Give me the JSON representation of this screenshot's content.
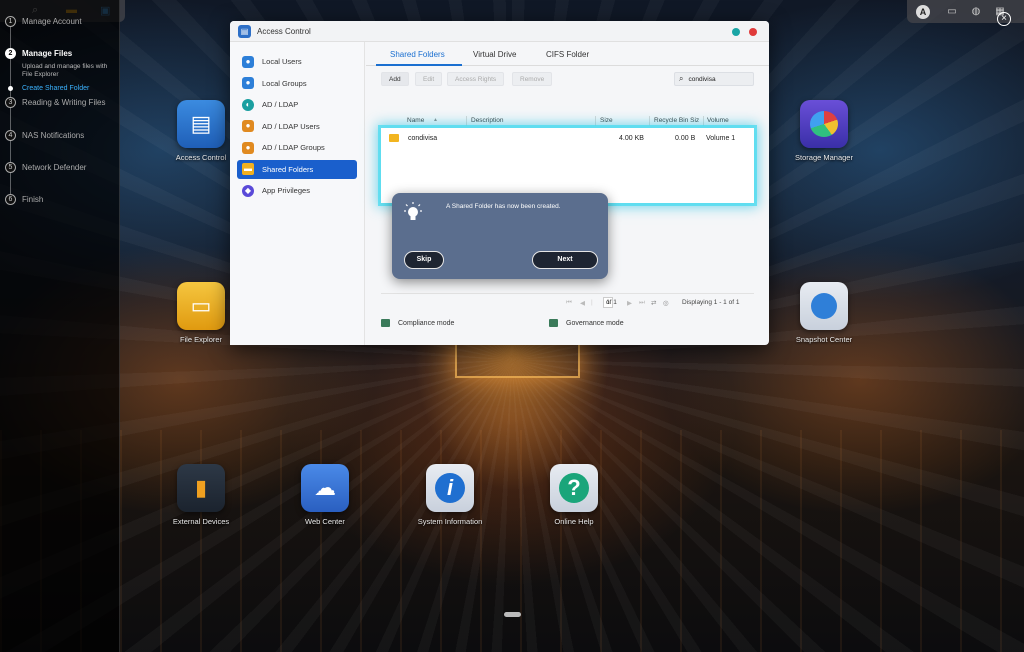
{
  "wizard": {
    "steps": [
      {
        "num": "1",
        "label": "Manage Account"
      },
      {
        "num": "2",
        "label": "Manage Files"
      },
      {
        "num": "3",
        "label": "Reading & Writing Files"
      },
      {
        "num": "4",
        "label": "NAS Notifications"
      },
      {
        "num": "5",
        "label": "Network Defender"
      },
      {
        "num": "6",
        "label": "Finish"
      }
    ],
    "sub_description": "Upload and manage files with File Explorer",
    "sub_current": "Create Shared Folder"
  },
  "desktop": {
    "icons": [
      {
        "label": "Access Control",
        "icon": "access-control-icon"
      },
      {
        "label": "File Explorer",
        "icon": "file-explorer-icon"
      },
      {
        "label": "External Devices",
        "icon": "usb-icon"
      },
      {
        "label": "Web Center",
        "icon": "web-center-icon"
      },
      {
        "label": "System Information",
        "icon": "info-icon"
      },
      {
        "label": "Online Help",
        "icon": "help-icon"
      },
      {
        "label": "Storage Manager",
        "icon": "storage-manager-icon"
      },
      {
        "label": "Snapshot Center",
        "icon": "snapshot-center-icon"
      }
    ]
  },
  "window": {
    "title": "Access Control",
    "sidebar": [
      {
        "label": "Local Users",
        "icon": "user-icon"
      },
      {
        "label": "Local Groups",
        "icon": "group-icon"
      },
      {
        "label": "AD / LDAP",
        "icon": "directory-icon"
      },
      {
        "label": "AD / LDAP Users",
        "icon": "user-icon"
      },
      {
        "label": "AD / LDAP Groups",
        "icon": "group-icon"
      },
      {
        "label": "Shared Folders",
        "icon": "folder-icon"
      },
      {
        "label": "App Privileges",
        "icon": "app-icon"
      }
    ],
    "tabs": [
      "Shared Folders",
      "Virtual Drive",
      "CIFS Folder"
    ],
    "toolbar": {
      "add": "Add",
      "edit": "Edit",
      "access_rights": "Access Rights",
      "remove": "Remove"
    },
    "search_value": "condivisa",
    "columns": [
      "Name",
      "Description",
      "Size",
      "Recycle Bin Siz",
      "Volume"
    ],
    "rows": [
      {
        "name": "condivisa",
        "description": "",
        "size": "4.00 KB",
        "recycle": "0.00 B",
        "volume": "Volume 1"
      }
    ],
    "pager": {
      "page": "1",
      "of": "of 1",
      "displaying": "Displaying 1 - 1 of 1"
    },
    "modes": [
      "Compliance mode",
      "Governance mode"
    ]
  },
  "popup": {
    "message": "A Shared Folder has now been created.",
    "skip": "Skip",
    "next": "Next"
  },
  "colors": {
    "accent": "#1a5fcc",
    "highlight": "#50dcf0",
    "popup_bg": "#5b6e8e"
  }
}
